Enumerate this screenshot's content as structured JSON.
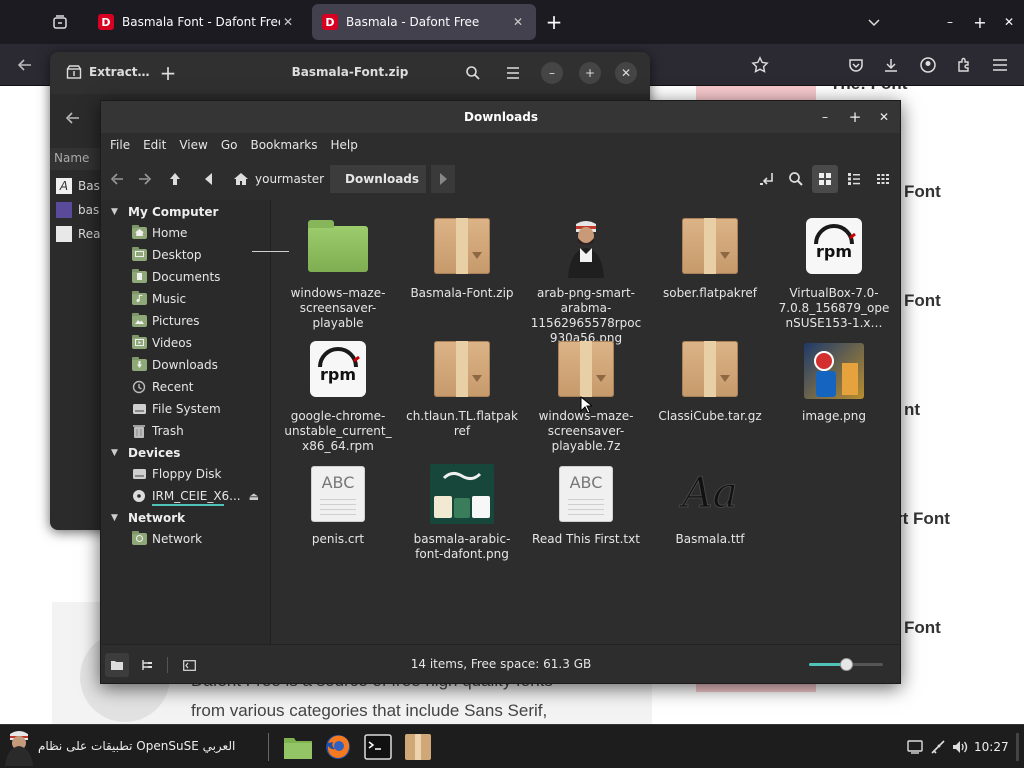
{
  "browser": {
    "tabs": [
      {
        "label": "Basmala Font - Dafont Free",
        "favicon": "D"
      },
      {
        "label": "Basmala - Dafont Free",
        "favicon": "D"
      }
    ]
  },
  "webpage": {
    "right_titles": [
      "Font",
      "Font",
      "nt",
      "fort Font",
      "Font"
    ],
    "right_partial_top": "The: Font",
    "paragraph_lines": [
      "Dafont Free is a source of free high quality fonts",
      "from various categories that include Sans Serif,"
    ]
  },
  "archive_manager": {
    "tab_label": "Extract…",
    "title": "Basmala-Font.zip",
    "column_header": "Name",
    "rows": [
      "Bas",
      "bas",
      "Rea"
    ]
  },
  "file_manager": {
    "title": "Downloads",
    "menu": [
      "File",
      "Edit",
      "View",
      "Go",
      "Bookmarks",
      "Help"
    ],
    "breadcrumbs": [
      {
        "label": "yourmaster"
      },
      {
        "label": "Downloads"
      }
    ],
    "sidebar": {
      "sections": [
        {
          "title": "My Computer",
          "items": [
            "Home",
            "Desktop",
            "Documents",
            "Music",
            "Pictures",
            "Videos",
            "Downloads",
            "Recent",
            "File System",
            "Trash"
          ]
        },
        {
          "title": "Devices",
          "items": [
            "Floppy Disk",
            "IRM_CEIE_X6..."
          ]
        },
        {
          "title": "Network",
          "items": [
            "Network"
          ]
        }
      ]
    },
    "files": [
      {
        "name": "windows–maze-screensaver-playable",
        "kind": "folder"
      },
      {
        "name": "Basmala-Font.zip",
        "kind": "archive"
      },
      {
        "name": "arab-png-smart-arabma-11562965578rpoc930a56.png",
        "kind": "person-image"
      },
      {
        "name": "sober.flatpakref",
        "kind": "archive"
      },
      {
        "name": "VirtualBox-7.0-7.0.8_156879_openSUSE153-1.x…",
        "kind": "rpm"
      },
      {
        "name": "google-chrome-unstable_current_x86_64.rpm",
        "kind": "rpm"
      },
      {
        "name": "ch.tlaun.TL.flatpakref",
        "kind": "archive"
      },
      {
        "name": "windows–maze-screensaver-playable.7z",
        "kind": "archive"
      },
      {
        "name": "ClassiCube.tar.gz",
        "kind": "archive"
      },
      {
        "name": "image.png",
        "kind": "photo"
      },
      {
        "name": "penis.crt",
        "kind": "text"
      },
      {
        "name": "basmala-arabic-font-dafont.png",
        "kind": "green-image"
      },
      {
        "name": "Read This First.txt",
        "kind": "text"
      },
      {
        "name": "Basmala.ttf",
        "kind": "font"
      }
    ],
    "status": "14 items, Free space: 61.3 GB",
    "zoom_level": 0.5,
    "icon_text": {
      "abc": "ABC",
      "rpm": "rpm",
      "font": "Aa"
    }
  },
  "taskbar": {
    "title": "تطبيقات على نظام OpenSuSE العربي",
    "clock": "10:27"
  },
  "colors": {
    "accent": "#4fc3b8",
    "folder_green": "#8fbc5e",
    "firefox_tab_bg": "#42414d",
    "dark_bg": "#2d2d2d"
  }
}
